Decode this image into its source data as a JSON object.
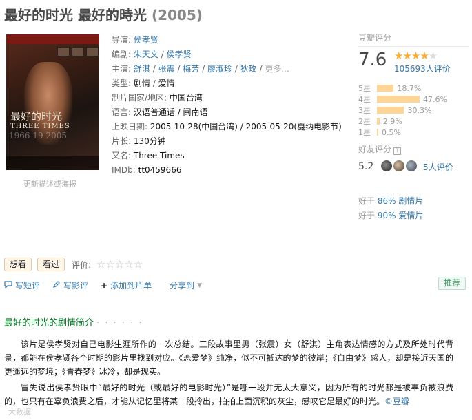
{
  "title": {
    "name": "最好的时光 最好的時光",
    "year": "(2005)"
  },
  "poster": {
    "title_text": "最好的时光",
    "subtitle_text": "THREE TIMES",
    "years_text": "1966 19 2005",
    "update_link": "更新描述或海报"
  },
  "info": {
    "director_label": "导演",
    "director": "侯孝贤",
    "writer_label": "编剧",
    "writers": [
      "朱天文",
      "侯孝贤"
    ],
    "cast_label": "主演",
    "cast": [
      "舒淇",
      "张震",
      "梅芳",
      "廖淑珍",
      "狄玫"
    ],
    "cast_more": "更多...",
    "genre_label": "类型",
    "genres": [
      "剧情",
      "爱情"
    ],
    "country_label": "制片国家/地区",
    "country": "中国台湾",
    "language_label": "语言",
    "language": "汉语普通话 / 闽南语",
    "release_label": "上映日期",
    "release": "2005-10-28(中国台湾) / 2005-05-20(戛纳电影节)",
    "runtime_label": "片长",
    "runtime": "130分钟",
    "aka_label": "又名",
    "aka": "Three Times",
    "imdb_label": "IMDb",
    "imdb": "tt0459666",
    "sep": " / ",
    "colon": ": "
  },
  "rating": {
    "header": "豆瓣评分",
    "score": "7.6",
    "stars": 4,
    "stars_total": 5,
    "votes": "105693人评价",
    "distribution": [
      {
        "label": "5星",
        "percent": 18.7,
        "text": "18.7%"
      },
      {
        "label": "4星",
        "percent": 47.6,
        "text": "47.6%"
      },
      {
        "label": "3星",
        "percent": 30.3,
        "text": "30.3%"
      },
      {
        "label": "2星",
        "percent": 2.9,
        "text": "2.9%"
      },
      {
        "label": "1星",
        "percent": 0.5,
        "text": "0.5%"
      }
    ],
    "star_color": "#ffac2d",
    "bar_color": "#ffd596"
  },
  "friends": {
    "header": "好友评分",
    "help_icon": "question-icon",
    "score": "5.2",
    "count": "5人评价"
  },
  "better_than": [
    {
      "prefix": "好于",
      "pct": "86%",
      "genre": "剧情片"
    },
    {
      "prefix": "好于",
      "pct": "90%",
      "genre": "爱情片"
    }
  ],
  "actions": {
    "want": "想看",
    "seen": "看过",
    "rate_label": "评价:",
    "rate_stars": "☆☆☆☆☆"
  },
  "tools": {
    "short_review": "写短评",
    "review": "写影评",
    "add_list": "添加到片单",
    "share": "分享到",
    "recommend": "推荐"
  },
  "synopsis": {
    "title": "最好的时光的剧情简介",
    "dots": "· · · · · ·",
    "p1": "该片是侯孝贤对自己电影生涯所作的一次总结。三段故事里男（张震）女（舒淇）主角表达情感的方式及所处时代背景，都能在侯孝贤各个时期的影片里找到对应。《恋爱梦》纯净，似不可抵达的梦的彼岸；《自由梦》感人，却是接近天国的更遥远的梦境；《青春梦》冰冷，却是现实。",
    "p2": "冒失说出侯孝贤眼中“最好的时光（或最好的电影时光）”是哪一段并无太大意义，因为所有的时光都是被辜负被浪费的，也只有在辜负浪费之后，才能从记忆里将某一段拎出，拍拍上面沉积的灰尘，感叹它是最好的时光。",
    "source": "©豆瓣"
  },
  "watermark": "大数据",
  "colors": {
    "link": "#3377aa",
    "green": "#007722",
    "score_text": "#494949"
  }
}
